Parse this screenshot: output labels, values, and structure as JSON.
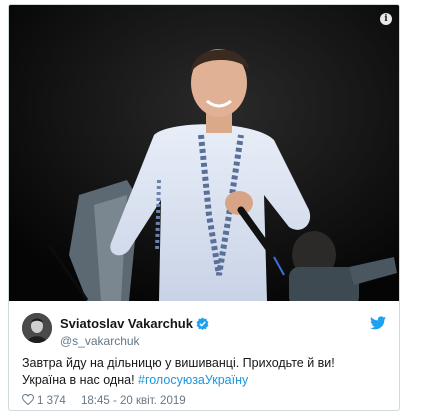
{
  "media": {
    "info_icon": "info-icon"
  },
  "tweet": {
    "display_name": "Sviatoslav Vakarchuk",
    "handle": "@s_vakarchuk",
    "text_line1": "Завтра йду на дільницю у вишиванці. Приходьте й ви!",
    "text_line2_prefix": "Україна в нас одна! ",
    "hashtag": "#голосуюзаУкраїну",
    "like_count": "1 374",
    "timestamp": "18:45 - 20 квіт. 2019"
  },
  "colors": {
    "link": "#1b95e0",
    "verified": "#1da1f2",
    "twitter_bird": "#1da1f2",
    "secondary_text": "#657786"
  }
}
